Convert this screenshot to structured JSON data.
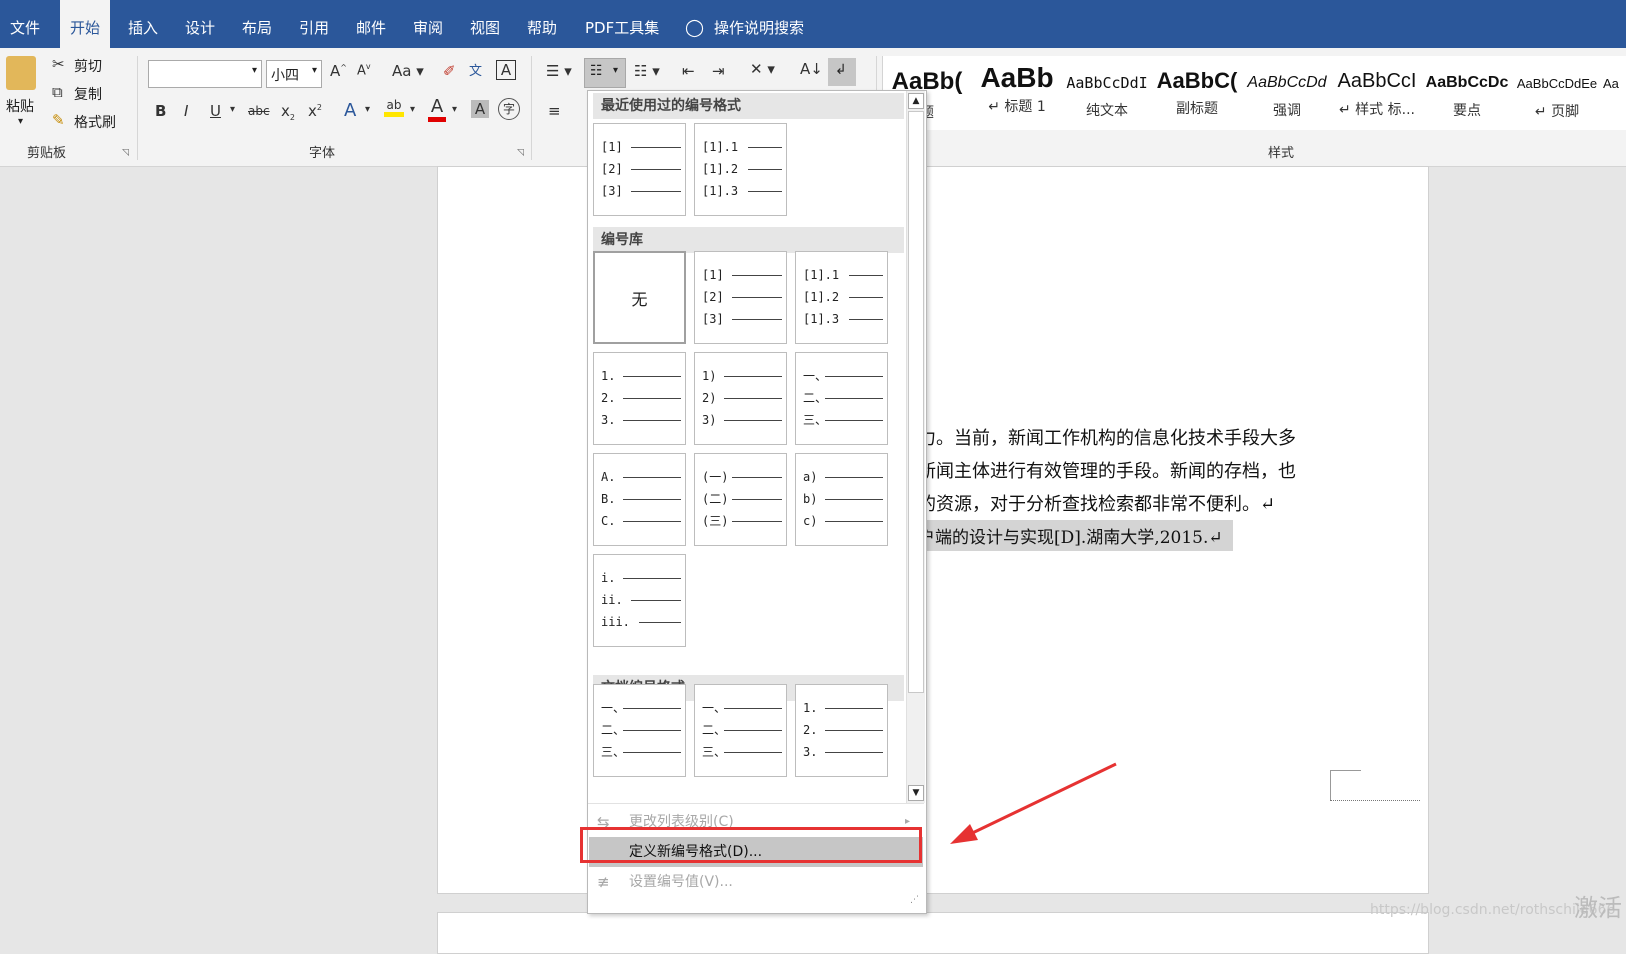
{
  "ribbon": {
    "tabs": [
      "文件",
      "开始",
      "插入",
      "设计",
      "布局",
      "引用",
      "邮件",
      "审阅",
      "视图",
      "帮助",
      "PDF工具集",
      "操作说明搜索"
    ],
    "clipboard": {
      "paste": "粘贴",
      "cut": "剪切",
      "copy": "复制",
      "format_painter": "格式刷",
      "group": "剪贴板"
    },
    "font": {
      "font_name": "",
      "font_size": "小四",
      "group": "字体",
      "grow": "A",
      "shrink": "A",
      "case": "Aa",
      "bold": "B",
      "italic": "I",
      "underline": "U",
      "strike": "abc",
      "sub": "x",
      "sup": "x"
    },
    "styles": {
      "group": "样式",
      "items": [
        {
          "preview": "AaBb(",
          "name": "题"
        },
        {
          "preview": "AaBb",
          "name": "↵ 标题 1"
        },
        {
          "preview": "AaBbCcDdI",
          "name": "纯文本"
        },
        {
          "preview": "AaBbC(",
          "name": "副标题"
        },
        {
          "preview": "AaBbCcDd",
          "name": "强调"
        },
        {
          "preview": "AaBbCcI",
          "name": "↵ 样式 标..."
        },
        {
          "preview": "AaBbCcDc",
          "name": "要点"
        },
        {
          "preview": "AaBbCcDdEe",
          "name": "↵ 页脚"
        },
        {
          "preview": "Aa",
          "name": ""
        }
      ]
    }
  },
  "numbering_menu": {
    "recent_header": "最近使用过的编号格式",
    "library_header": "编号库",
    "document_header": "文档编号格式",
    "none_label": "无",
    "recent": [
      [
        "[1]",
        "[2]",
        "[3]"
      ],
      [
        "[1].1",
        "[1].2",
        "[1].3"
      ]
    ],
    "library": [
      [
        "[1]",
        "[2]",
        "[3]"
      ],
      [
        "[1].1",
        "[1].2",
        "[1].3"
      ],
      [
        "1.",
        "2.",
        "3."
      ],
      [
        "1)",
        "2)",
        "3)"
      ],
      [
        "一、",
        "二、",
        "三、"
      ],
      [
        "A.",
        "B.",
        "C."
      ],
      [
        "(一)",
        "(二)",
        "(三)"
      ],
      [
        "a)",
        "b)",
        "c)"
      ],
      [
        "i.",
        "ii.",
        "iii."
      ]
    ],
    "document": [
      [
        "一、",
        "二、",
        "三、"
      ],
      [
        "一、",
        "二、",
        "三、"
      ],
      [
        "1.",
        "2.",
        "3."
      ]
    ],
    "change_level": "更改列表级别(C)",
    "define_new": "定义新编号格式(D)...",
    "set_value": "设置编号值(V)..."
  },
  "document": {
    "lines": [
      "力。当前，新闻工作机构的信息化技术手段大多",
      "新闻主体进行有效管理的手段。新闻的存档，也",
      "的资源，对于分析查找检索都非常不便利。↵",
      "户端的设计与实现[D].湖南大学,2015.↵"
    ]
  },
  "watermark": {
    "url": "https://blog.csdn.net/rothschild666",
    "activate": "激活"
  },
  "colors": {
    "accent": "#2b579a",
    "highlight": "#e63232"
  }
}
